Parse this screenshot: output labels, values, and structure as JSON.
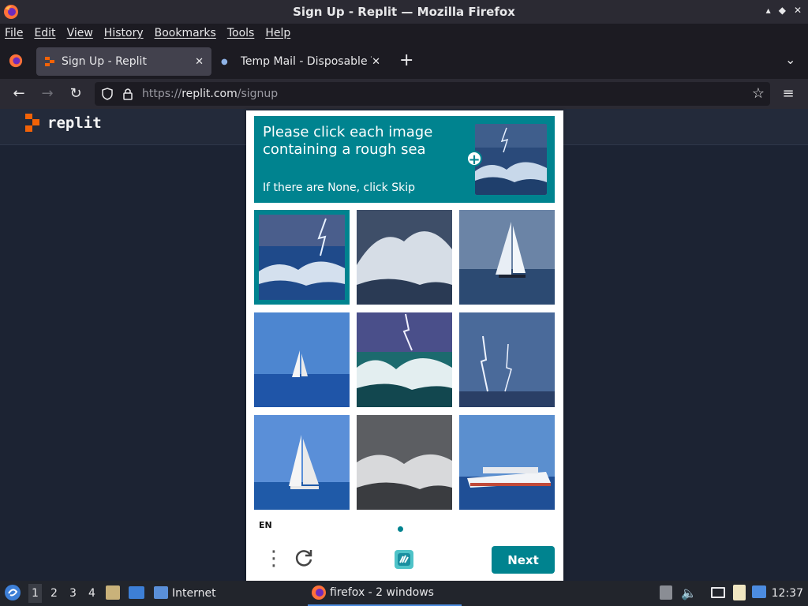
{
  "window": {
    "title": "Sign Up - Replit — Mozilla Firefox",
    "controls": [
      "▴",
      "◆",
      "✕"
    ]
  },
  "menu": [
    "File",
    "Edit",
    "View",
    "History",
    "Bookmarks",
    "Tools",
    "Help"
  ],
  "tabs": [
    {
      "label": "Sign Up - Replit",
      "active": true
    },
    {
      "label": "Temp Mail - Disposable Te",
      "active": false
    }
  ],
  "url": {
    "prefix": "https://",
    "domain": "replit.com",
    "path": "/signup"
  },
  "page": {
    "brand": "replit"
  },
  "captcha": {
    "prompt_line1": "Please click each image",
    "prompt_line2": "containing a rough sea",
    "sub": "If there are None, click Skip",
    "tiles": [
      {
        "subject": "rough sea with lightning",
        "selected": true
      },
      {
        "subject": "rough sea wave",
        "selected": false
      },
      {
        "subject": "sailboat calm sea",
        "selected": false
      },
      {
        "subject": "sailboat blue sea",
        "selected": false
      },
      {
        "subject": "rough sea with lightning",
        "selected": false
      },
      {
        "subject": "lightning over sea",
        "selected": false
      },
      {
        "subject": "sailboat",
        "selected": false
      },
      {
        "subject": "rough sea grey",
        "selected": false
      },
      {
        "subject": "cruise ship",
        "selected": false
      }
    ],
    "language": "EN",
    "next_label": "Next"
  },
  "taskbar": {
    "workspaces": [
      "1",
      "2",
      "3",
      "4"
    ],
    "internet_label": "Internet",
    "task_label": "firefox - 2 windows",
    "clock": "12:37"
  },
  "colors": {
    "accent": "#00838f",
    "chrome": "#2b2a33",
    "page_bg": "#1c2333"
  }
}
